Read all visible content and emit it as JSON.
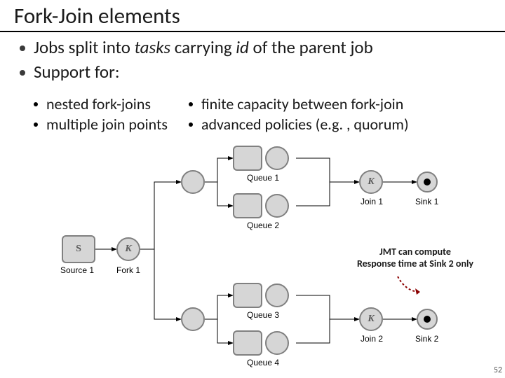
{
  "title": "Fork-Join elements",
  "bullets": {
    "b1_pre": "Jobs split into ",
    "b1_tasks": "tasks",
    "b1_mid": " carrying ",
    "b1_id": "id",
    "b1_post": " of the parent job",
    "b2": "Support for:"
  },
  "sub": {
    "s1": "nested fork-joins",
    "s2": "multiple join points",
    "s3": "finite capacity between fork-join",
    "s4": "advanced policies (e.g. , quorum)"
  },
  "diagram": {
    "source1": "Source 1",
    "fork1": "Fork 1",
    "queue1": "Queue 1",
    "queue2": "Queue 2",
    "queue3": "Queue 3",
    "queue4": "Queue 4",
    "join1": "Join 1",
    "join2": "Join 2",
    "sink1": "Sink 1",
    "sink2": "Sink 2",
    "source_glyph": "S",
    "fork_glyph": "K",
    "join_glyph": "K"
  },
  "caption": {
    "l1": "JMT can compute",
    "l2": "Response time at Sink 2 only"
  },
  "pagenum": "52"
}
